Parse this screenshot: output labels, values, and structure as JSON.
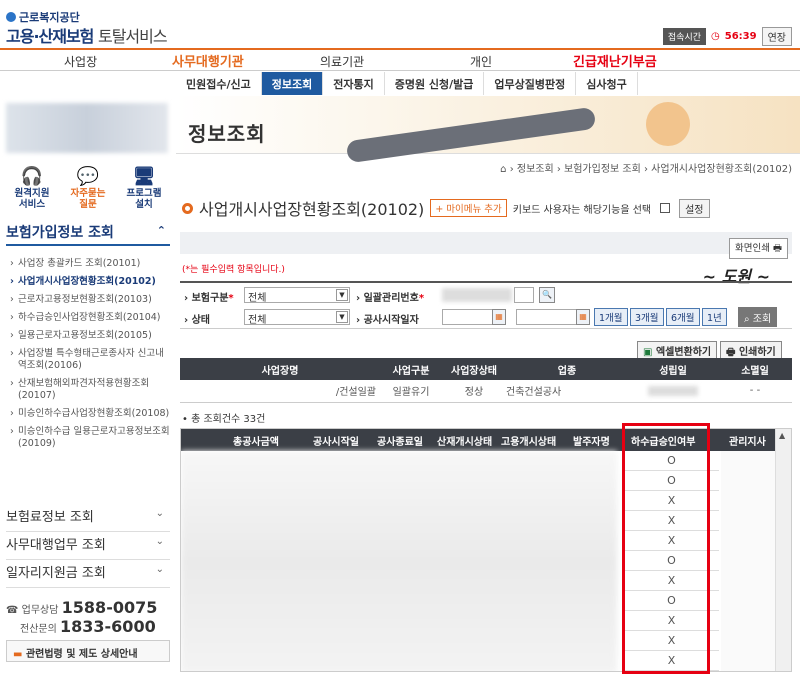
{
  "header": {
    "org": "근로복지공단",
    "title_main": "고용·산재보험",
    "title_sub": "토탈서비스",
    "session_label": "접속시간",
    "timer": "56:39",
    "extend_label": "연장"
  },
  "topnav": {
    "items": [
      "사업장",
      "사무대행기관",
      "의료기관",
      "개인",
      "긴급재난기부금"
    ]
  },
  "subnav": {
    "tabs": [
      "민원접수/신고",
      "정보조회",
      "전자통지",
      "증명원 신청/발급",
      "업무상질병판정",
      "심사청구"
    ],
    "active": "정보조회"
  },
  "quick": [
    {
      "icon": "headset-icon",
      "label1": "원격지원",
      "label2": "서비스"
    },
    {
      "icon": "chat-icon",
      "label1": "자주묻는",
      "label2": "질문"
    },
    {
      "icon": "monitor-icon",
      "label1": "프로그램",
      "label2": "설치"
    }
  ],
  "sidebar": {
    "section_title": "보험가입정보 조회",
    "items": [
      "사업장 총괄카드 조회(20101)",
      "사업개시사업장현황조회(20102)",
      "근로자고용정보현황조회(20103)",
      "하수급승인사업장현황조회(20104)",
      "일용근로자고용정보조회(20105)",
      "사업장별 특수형태근로종사자 신고내역조회(20106)",
      "산재보험해외파견자적용현황조회(20107)",
      "미승인하수급사업장현황조회(20108)",
      "미승인하수급 일용근로자고용정보조회(20109)"
    ],
    "sections": [
      "보험료정보 조회",
      "사무대행업무 조회",
      "일자리지원금 조회"
    ],
    "phone1_label": "업무상담",
    "phone1": "1588-0075",
    "phone2_label": "전산문의",
    "phone2": "1833-6000",
    "law_link": "관련법령 및 제도 상세안내"
  },
  "banner": {
    "title": "정보조회"
  },
  "breadcrumb": "› 정보조회 › 보험가입정보 조회 › 사업개시사업장현황조회(20102)",
  "page": {
    "title": "사업개시사업장현황조회(20102)",
    "mymenu": "+ 마이메뉴 추가",
    "keyboard_text": "키보드 사용자는 해당기능을 선택",
    "setting": "설정",
    "print_screen": "화면인쇄",
    "required_note": "(*는 필수입력 항목입니다.)"
  },
  "form": {
    "insurance_label": "보험구분",
    "insurance_value": "전체",
    "mgmt_label": "일괄관리번호",
    "status_label": "상태",
    "status_value": "전체",
    "start_label": "공사시작일자",
    "periods": [
      "1개월",
      "3개월",
      "6개월",
      "1년"
    ],
    "search": "조회"
  },
  "actions": {
    "excel": "엑셀변환하기",
    "print": "인쇄하기"
  },
  "table1": {
    "headers": [
      "사업장명",
      "사업구분",
      "사업장상태",
      "업종",
      "성립일",
      "소멸일"
    ],
    "row": [
      "/건설일괄",
      "일괄유기",
      "정상",
      "건축건설공사",
      "",
      "- -"
    ]
  },
  "count_text": "• 총 조회건수 33건",
  "grid": {
    "headers": [
      "총공사금액",
      "공사시작일",
      "공사종료일",
      "산재개시상태",
      "고용개시상태",
      "발주자명",
      "하수급승인여부",
      "관리지사"
    ],
    "subcontract_values": [
      "O",
      "O",
      "X",
      "X",
      "X",
      "O",
      "X",
      "O",
      "X",
      "X",
      "X"
    ]
  }
}
